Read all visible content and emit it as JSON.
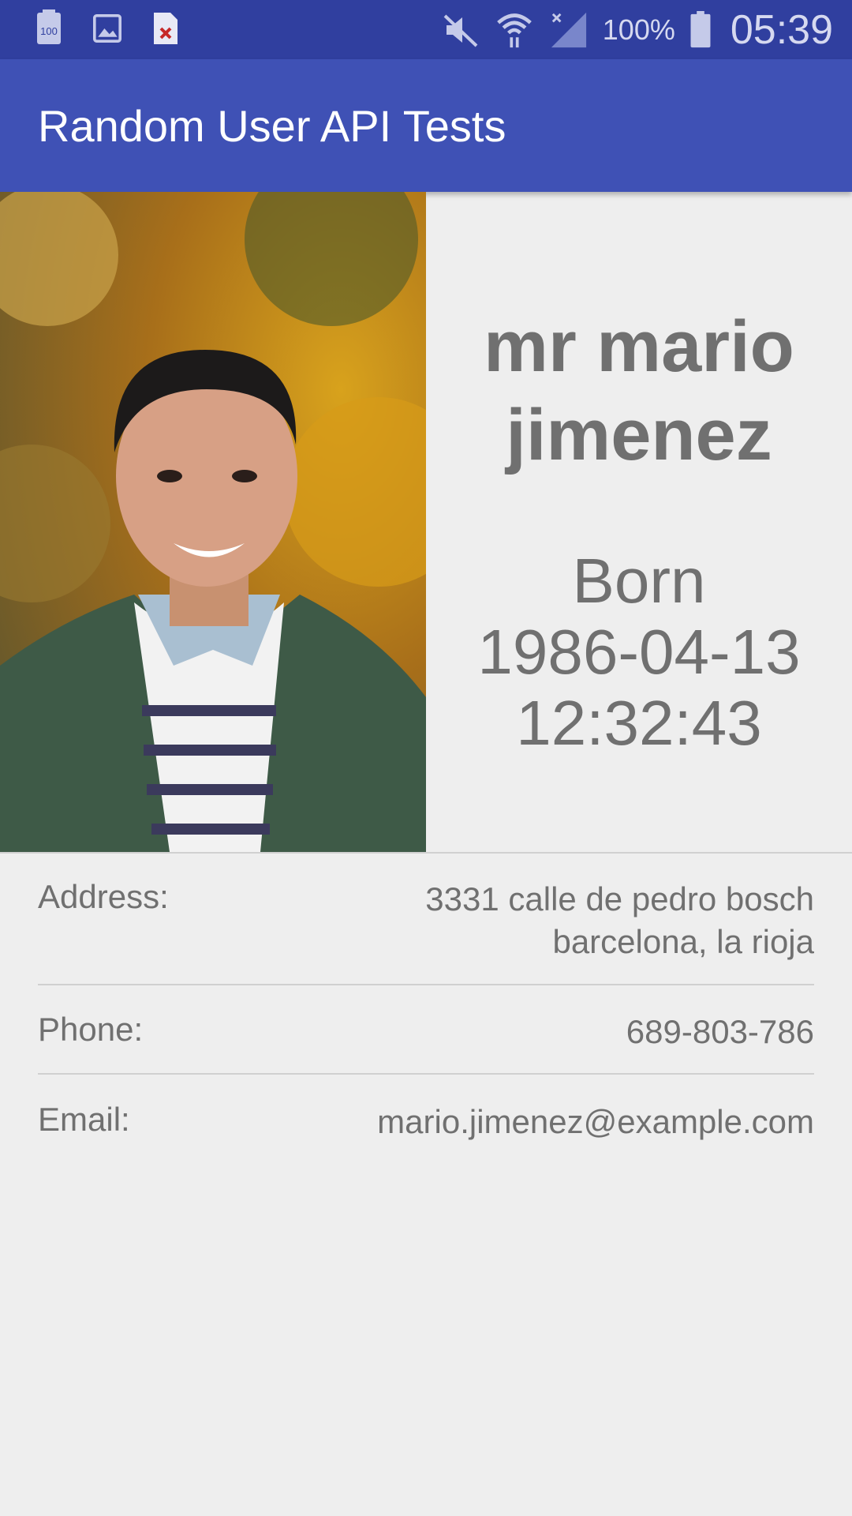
{
  "status_bar": {
    "icons_left": [
      "storage-icon",
      "image-icon",
      "file-error-icon"
    ],
    "icons_right": [
      "mute-icon",
      "wifi-icon",
      "signal-icon",
      "battery-icon"
    ],
    "battery_percent": "100%",
    "time": "05:39"
  },
  "app_bar": {
    "title": "Random User API Tests"
  },
  "profile": {
    "name_line1": "mr mario",
    "name_line2": "jimenez",
    "born_label": "Born",
    "born_date": "1986-04-13",
    "born_time": "12:32:43"
  },
  "details": {
    "address": {
      "label": "Address:",
      "line1": "3331 calle de pedro bosch",
      "line2": "barcelona, la rioja"
    },
    "phone": {
      "label": "Phone:",
      "value": "689-803-786"
    },
    "email": {
      "label": "Email:",
      "value": "mario.jimenez@example.com"
    }
  },
  "colors": {
    "status_bar": "#303f9f",
    "app_bar": "#3f51b5",
    "background": "#eeeeee",
    "text": "#707070"
  }
}
